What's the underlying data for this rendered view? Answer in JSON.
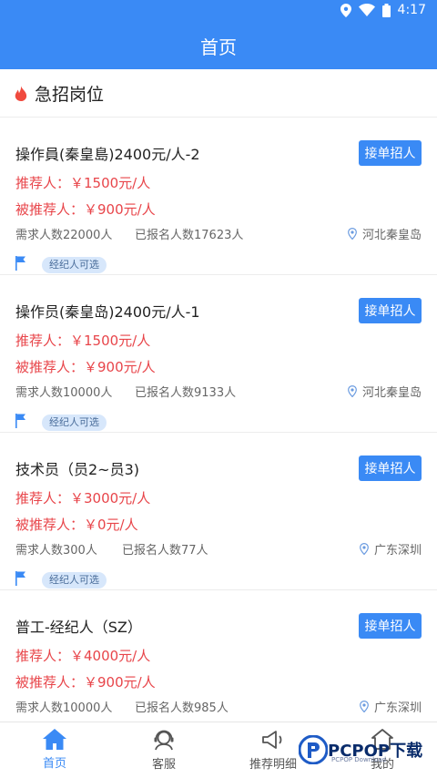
{
  "status_bar": {
    "time": "4:17",
    "icons": [
      "location-icon",
      "wifi-icon",
      "battery-icon"
    ]
  },
  "app_bar": {
    "title": "首页"
  },
  "section": {
    "title": "急招岗位",
    "icon": "fire-icon"
  },
  "jobs": [
    {
      "title": "操作員(秦皇島)2400元/人-2",
      "button": "接单招人",
      "recommender": "推荐人：￥1500元/人",
      "recommended": "被推荐人：￥900元/人",
      "need": "需求人数22000人",
      "signed": "已报名人数17623人",
      "location": "河北秦皇岛",
      "tag": "经纪人可选"
    },
    {
      "title": "操作员(秦皇岛)2400元/人-1",
      "button": "接单招人",
      "recommender": "推荐人：￥1500元/人",
      "recommended": "被推荐人：￥900元/人",
      "need": "需求人数10000人",
      "signed": "已报名人数9133人",
      "location": "河北秦皇岛",
      "tag": "经纪人可选"
    },
    {
      "title": "技术员（员2~员3)",
      "button": "接单招人",
      "recommender": "推荐人：￥3000元/人",
      "recommended": "被推荐人：￥0元/人",
      "need": "需求人数300人",
      "signed": "已报名人数77人",
      "location": "广东深圳",
      "tag": "经纪人可选"
    },
    {
      "title": "普工-经纪人（SZ）",
      "button": "接单招人",
      "recommender": "推荐人：￥4000元/人",
      "recommended": "被推荐人：￥900元/人",
      "need": "需求人数10000人",
      "signed": "已报名人数985人",
      "location": "广东深圳",
      "tag": ""
    }
  ],
  "tabs": [
    {
      "label": "首页",
      "icon": "home-icon",
      "active": true
    },
    {
      "label": "客服",
      "icon": "customer-service-icon",
      "active": false
    },
    {
      "label": "推荐明细",
      "icon": "megaphone-icon",
      "active": false
    },
    {
      "label": "我的",
      "icon": "profile-icon",
      "active": false
    }
  ],
  "watermark": {
    "main": "PCPOP下载",
    "sub": "PCPOP Download"
  },
  "colors": {
    "primary": "#3a8af5",
    "price": "#e8454a",
    "tag_bg": "#d7e7fb"
  }
}
